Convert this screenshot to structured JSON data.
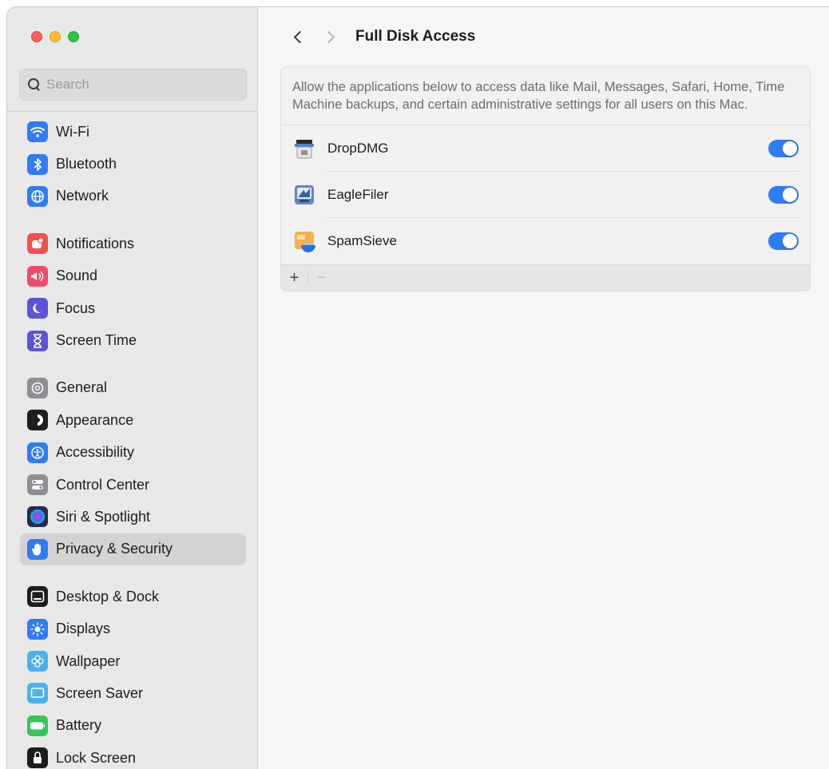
{
  "window": {
    "controls": [
      "close",
      "minimize",
      "zoom"
    ]
  },
  "search": {
    "placeholder": "Search",
    "value": ""
  },
  "sidebar": {
    "groups": [
      [
        {
          "label": "Wi-Fi",
          "icon": "wifi-icon",
          "color": "#2f7cf6"
        },
        {
          "label": "Bluetooth",
          "icon": "bluetooth-icon",
          "color": "#2f7cf6"
        },
        {
          "label": "Network",
          "icon": "globe-icon",
          "color": "#2f7cf6"
        }
      ],
      [
        {
          "label": "Notifications",
          "icon": "notifications-icon",
          "color": "#f0524d"
        },
        {
          "label": "Sound",
          "icon": "speaker-icon",
          "color": "#ef4a6a"
        },
        {
          "label": "Focus",
          "icon": "moon-icon",
          "color": "#5b54d6"
        },
        {
          "label": "Screen Time",
          "icon": "hourglass-icon",
          "color": "#5b54d6"
        }
      ],
      [
        {
          "label": "General",
          "icon": "gear-icon",
          "color": "#8e8e93"
        },
        {
          "label": "Appearance",
          "icon": "appearance-icon",
          "color": "#1d1d1f"
        },
        {
          "label": "Accessibility",
          "icon": "accessibility-icon",
          "color": "#2f7cf6"
        },
        {
          "label": "Control Center",
          "icon": "control-center-icon",
          "color": "#8e8e93"
        },
        {
          "label": "Siri & Spotlight",
          "icon": "siri-icon",
          "color": "#2a2a4a"
        },
        {
          "label": "Privacy & Security",
          "icon": "hand-icon",
          "color": "#2f7cf6",
          "selected": true
        }
      ],
      [
        {
          "label": "Desktop & Dock",
          "icon": "dock-icon",
          "color": "#1d1d1f"
        },
        {
          "label": "Displays",
          "icon": "sun-icon",
          "color": "#2f7cf6"
        },
        {
          "label": "Wallpaper",
          "icon": "flower-icon",
          "color": "#4ab1f0"
        },
        {
          "label": "Screen Saver",
          "icon": "screensaver-icon",
          "color": "#4ab1f0"
        },
        {
          "label": "Battery",
          "icon": "battery-icon",
          "color": "#34c759"
        },
        {
          "label": "Lock Screen",
          "icon": "lock-icon",
          "color": "#1d1d1f"
        }
      ]
    ]
  },
  "header": {
    "back_icon": "chevron-left-icon",
    "forward_icon": "chevron-right-icon",
    "title": "Full Disk Access"
  },
  "panel": {
    "description": "Allow the applications below to access data like Mail, Messages, Safari, Home, Time Machine backups, and certain administrative settings for all users on this Mac.",
    "apps": [
      {
        "name": "DropDMG",
        "enabled": true,
        "icon": "dropdmg-icon"
      },
      {
        "name": "EagleFiler",
        "enabled": true,
        "icon": "eaglefiler-icon"
      },
      {
        "name": "SpamSieve",
        "enabled": true,
        "icon": "spamsieve-icon"
      }
    ],
    "footer": {
      "add_label": "+",
      "remove_label": "−"
    }
  },
  "colors": {
    "accent": "#2f7cf6",
    "sidebar_bg": "#e9e8e8",
    "content_bg": "#f6f6f6",
    "selected_row": "#d4d3d3"
  }
}
